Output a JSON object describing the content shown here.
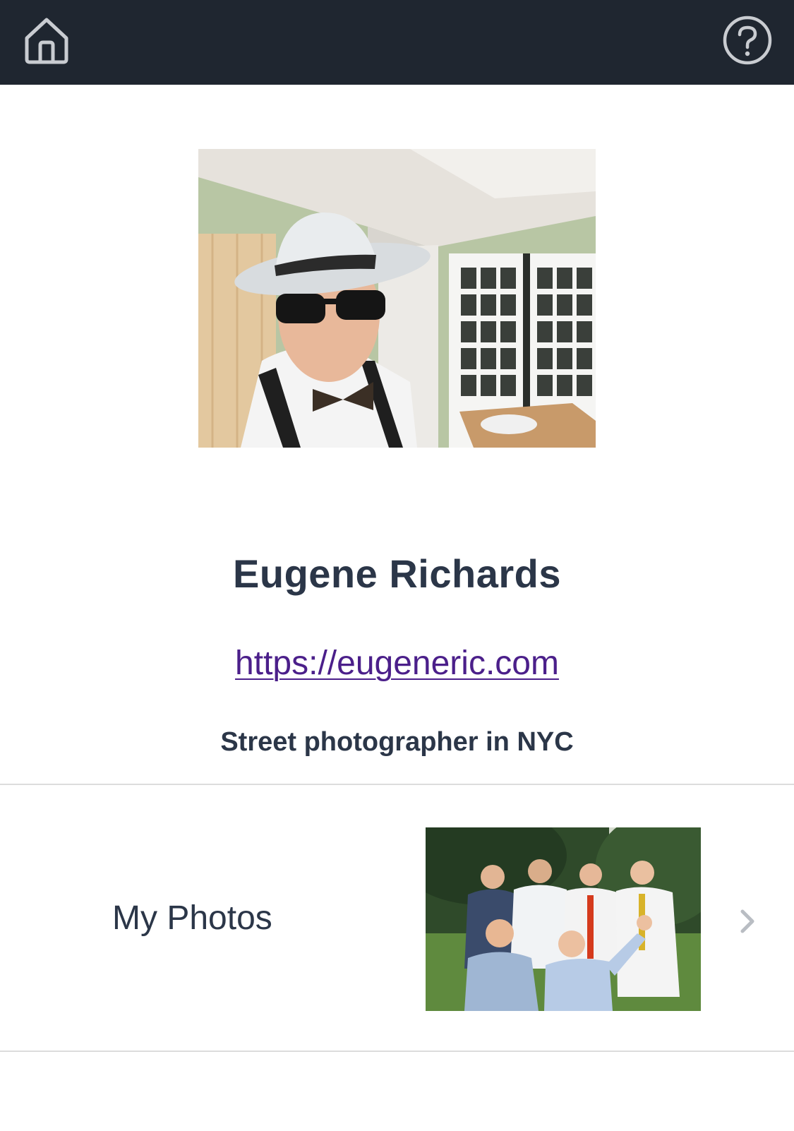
{
  "header": {
    "home_icon": "home-icon",
    "help_icon": "help-circle-icon",
    "background_color": "#1f2630"
  },
  "profile": {
    "name": "Eugene Richards",
    "website": "https://eugeneric.com",
    "bio": "Street photographer in NYC"
  },
  "photos_row": {
    "label": "My Photos",
    "chevron_icon": "chevron-right-icon"
  },
  "colors": {
    "text_dark": "#2b3648",
    "link": "#4b1f8a",
    "divider": "#dcdcdc"
  }
}
